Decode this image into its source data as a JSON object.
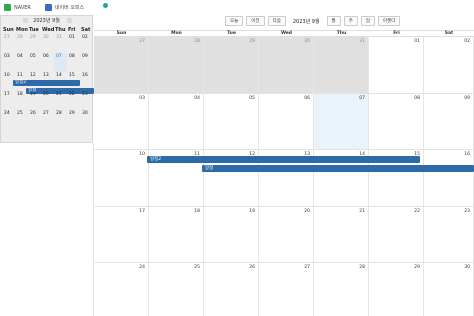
{
  "bookmarks": [
    {
      "label": "NAVER",
      "icon": "naver-icon",
      "color": "#2fa84f"
    },
    {
      "label": "네이버 오피스",
      "icon": "office-icon",
      "color": "#3a6bc7"
    }
  ],
  "mini_calendar": {
    "title": "2023년 9월",
    "days_of_week": [
      "Sun",
      "Mon",
      "Tue",
      "Wed",
      "Thu",
      "Fri",
      "Sat"
    ],
    "weeks": [
      [
        "27",
        "28",
        "29",
        "30",
        "31",
        "01",
        "02"
      ],
      [
        "03",
        "04",
        "05",
        "06",
        "07",
        "08",
        "09"
      ],
      [
        "10",
        "11",
        "12",
        "13",
        "14",
        "15",
        "16"
      ],
      [
        "17",
        "18",
        "19",
        "20",
        "21",
        "22",
        "23"
      ],
      [
        "24",
        "25",
        "26",
        "27",
        "28",
        "29",
        "30"
      ]
    ],
    "events": [
      "일정2",
      "일정"
    ]
  },
  "toolbar": {
    "today_label": "오늘",
    "prev_label": "이전",
    "next_label": "다음",
    "title": "2023년 9월",
    "month_label": "월",
    "week_label": "주",
    "day_label": "일",
    "agenda_label": "아젠다"
  },
  "month": {
    "days_of_week": [
      "Sun",
      "Mon",
      "Tue",
      "Wed",
      "Thu",
      "Fri",
      "Sat"
    ],
    "weeks": [
      [
        "27",
        "28",
        "29",
        "30",
        "31",
        "01",
        "02"
      ],
      [
        "03",
        "04",
        "05",
        "06",
        "07",
        "08",
        "09"
      ],
      [
        "10",
        "11",
        "12",
        "13",
        "14",
        "15",
        "16"
      ],
      [
        "17",
        "18",
        "19",
        "20",
        "21",
        "22",
        "23"
      ],
      [
        "24",
        "25",
        "26",
        "27",
        "28",
        "29",
        "30"
      ]
    ],
    "events": [
      {
        "title": "일정2"
      },
      {
        "title": "일정"
      }
    ]
  },
  "colors": {
    "event": "#2e6aa8",
    "today": "#e8f3fc",
    "other_month": "#e0e0e0"
  }
}
